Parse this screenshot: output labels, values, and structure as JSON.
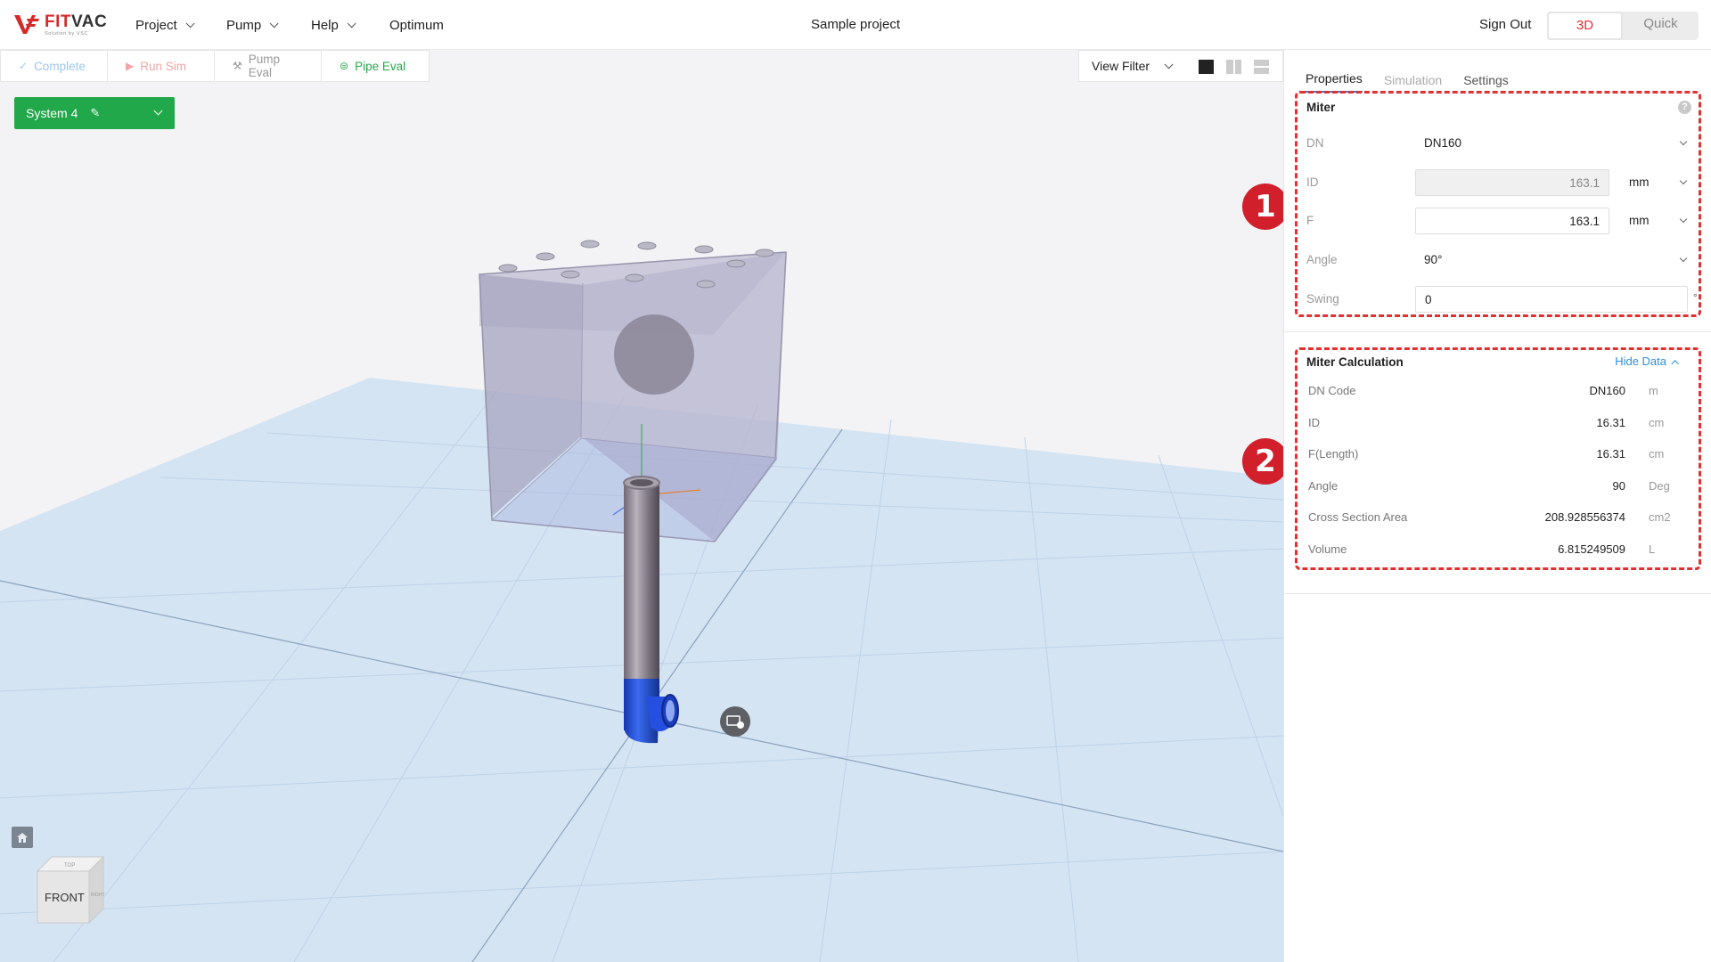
{
  "app": {
    "logo_name_red": "FIT",
    "logo_name": "VAC",
    "logo_tagline": "Solution by VSC",
    "project_title": "Sample project",
    "sign_out": "Sign Out"
  },
  "menu": [
    {
      "label": "Project"
    },
    {
      "label": "Pump"
    },
    {
      "label": "Help"
    },
    {
      "label": "Optimum"
    }
  ],
  "mode_toggle": {
    "option_3d": "3D",
    "option_quick": "Quick",
    "selected": "3D"
  },
  "toolbar": {
    "complete": "Complete",
    "run_sim": "Run Sim",
    "pump_eval": "Pump Eval",
    "pipe_eval": "Pipe Eval"
  },
  "view_filter": {
    "label": "View Filter"
  },
  "system_button": {
    "label": "System 4"
  },
  "viewcube": {
    "front": "FRONT",
    "top": "TOP",
    "right": "RIGHT"
  },
  "panel": {
    "tabs": [
      {
        "label": "Properties",
        "active": true
      },
      {
        "label": "Simulation",
        "active": false
      },
      {
        "label": "Settings",
        "active": false
      }
    ],
    "miter": {
      "title": "Miter",
      "help_glyph": "?",
      "fields": {
        "dn": {
          "label": "DN",
          "value": "DN160"
        },
        "id": {
          "label": "ID",
          "value": "163.1",
          "unit": "mm"
        },
        "f": {
          "label": "F",
          "value": "163.1",
          "unit": "mm"
        },
        "angle": {
          "label": "Angle",
          "value": "90°"
        },
        "swing": {
          "label": "Swing",
          "value": "0",
          "unit": "°"
        }
      }
    },
    "calculation": {
      "title": "Miter Calculation",
      "toggle_label": "Hide Data",
      "rows": [
        {
          "label": "DN Code",
          "value": "DN160",
          "unit": "m"
        },
        {
          "label": "ID",
          "value": "16.31",
          "unit": "cm"
        },
        {
          "label": "F(Length)",
          "value": "16.31",
          "unit": "cm"
        },
        {
          "label": "Angle",
          "value": "90",
          "unit": "Deg"
        },
        {
          "label": "Cross Section Area",
          "value": "208.928556374",
          "unit": "cm2"
        },
        {
          "label": "Volume",
          "value": "6.815249509",
          "unit": "L"
        }
      ]
    }
  },
  "callouts": {
    "one": "1",
    "two": "2"
  },
  "colors": {
    "accent_green": "#21a84a",
    "accent_red": "#e03131",
    "link_blue": "#2c8fe0",
    "pipe_blue": "#1f4fd6",
    "ground": "#d4e4f3"
  }
}
